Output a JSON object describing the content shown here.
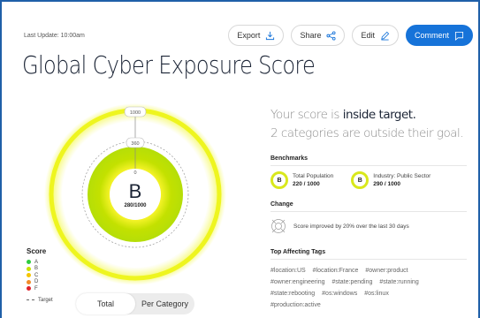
{
  "header": {
    "last_update": "Last Update: 10:00am",
    "title": "Global Cyber Exposure Score"
  },
  "toolbar": {
    "export_label": "Export",
    "share_label": "Share",
    "edit_label": "Edit",
    "comment_label": "Comment"
  },
  "gauge": {
    "grade": "B",
    "score_text": "280/1000",
    "score": 280,
    "max": 1000,
    "tick_max": "1000",
    "tick_target": "360",
    "tick_zero": "0"
  },
  "legend": {
    "title": "Score",
    "items": [
      {
        "label": "A",
        "color": "#2ecc40"
      },
      {
        "label": "B",
        "color": "#c8e000"
      },
      {
        "label": "C",
        "color": "#f5c400"
      },
      {
        "label": "D",
        "color": "#f28c28"
      },
      {
        "label": "F",
        "color": "#e0202a"
      }
    ],
    "target_label": "Target"
  },
  "view_toggle": {
    "total_label": "Total",
    "per_category_label": "Per Category",
    "active": "Total"
  },
  "summary": {
    "line1_prefix": "Your score is ",
    "line1_emphasis": "inside target.",
    "line2": "2 categories are outside their goal."
  },
  "benchmarks": {
    "title": "Benchmarks",
    "items": [
      {
        "grade": "B",
        "label": "Total Population",
        "value": "220 / 1000"
      },
      {
        "grade": "B",
        "label": "Industry: Public Sector",
        "value": "290 / 1000"
      }
    ]
  },
  "change": {
    "title": "Change",
    "text": "Score improved by 20% over the last 30 days"
  },
  "tags": {
    "title": "Top Affecting Tags",
    "items": [
      "#location:US",
      "#location:France",
      "#owner:product",
      "#owner:engineering",
      "#state:pending",
      "#state:running",
      "#state:rebooting",
      "#os:windows",
      "#os:linux",
      "#production:active"
    ]
  },
  "colors": {
    "accent": "#1673d9",
    "frame": "#1f5fa8",
    "ring_yellow": "#e8f21a",
    "grade_b": "#c8e000"
  }
}
